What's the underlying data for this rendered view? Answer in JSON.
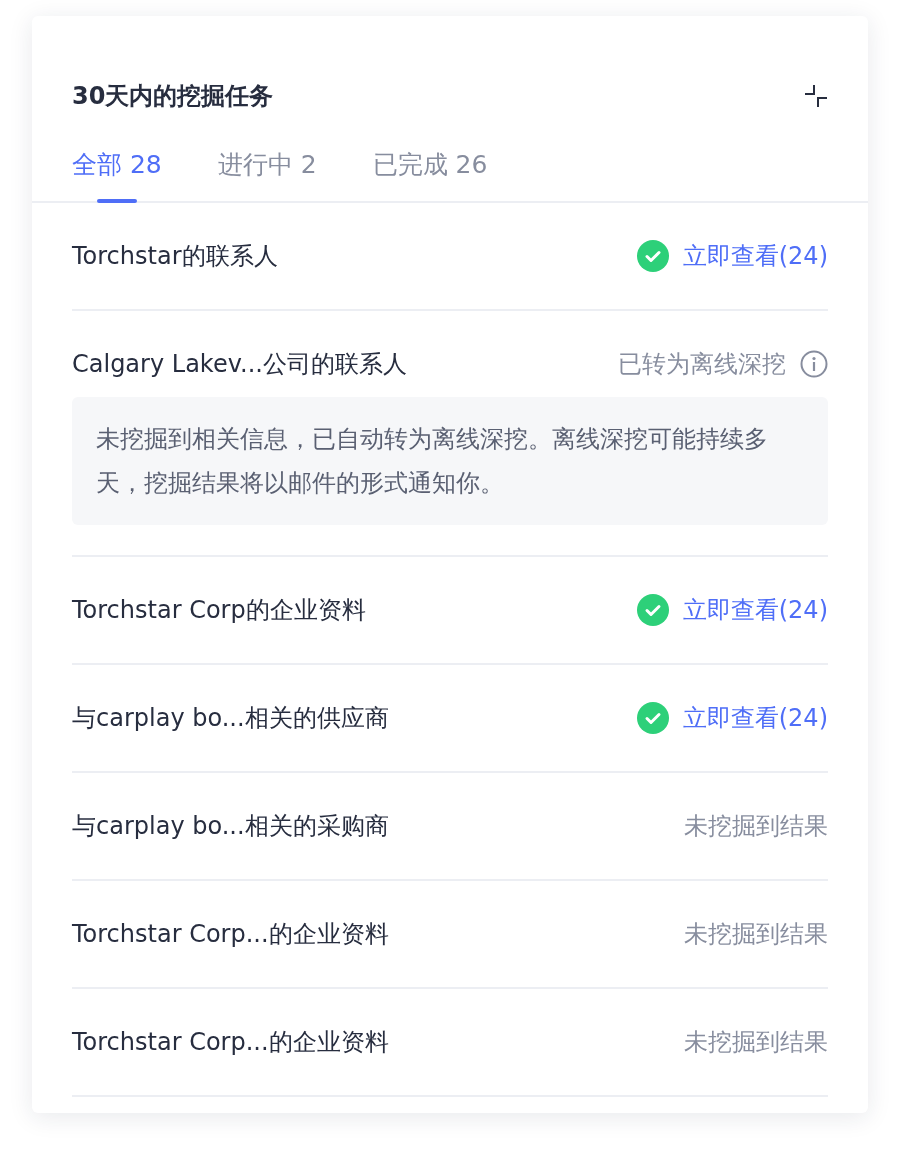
{
  "title": "30天内的挖掘任务",
  "tabs": [
    {
      "label": "全部 28",
      "selected": true
    },
    {
      "label": "进行中 2",
      "selected": false
    },
    {
      "label": "已完成 26",
      "selected": false
    }
  ],
  "tasks": [
    {
      "kind": "done",
      "name": "Torchstar的联系人",
      "action": "立即查看(24)"
    },
    {
      "kind": "offline",
      "name": "Calgary Lakev...公司的联系人",
      "status": "已转为离线深挖",
      "note": "未挖掘到相关信息，已自动转为离线深挖。离线深挖可能持续多天，挖掘结果将以邮件的形式通知你。"
    },
    {
      "kind": "done",
      "name": "Torchstar Corp的企业资料",
      "action": "立即查看(24)"
    },
    {
      "kind": "done",
      "name": "与carplay bo...相关的供应商",
      "action": "立即查看(24)"
    },
    {
      "kind": "none",
      "name": "与carplay bo...相关的采购商",
      "status": "未挖掘到结果"
    },
    {
      "kind": "none",
      "name": "Torchstar Corp...的企业资料",
      "status": "未挖掘到结果"
    },
    {
      "kind": "none",
      "name": "Torchstar Corp...的企业资料",
      "status": "未挖掘到结果"
    }
  ]
}
